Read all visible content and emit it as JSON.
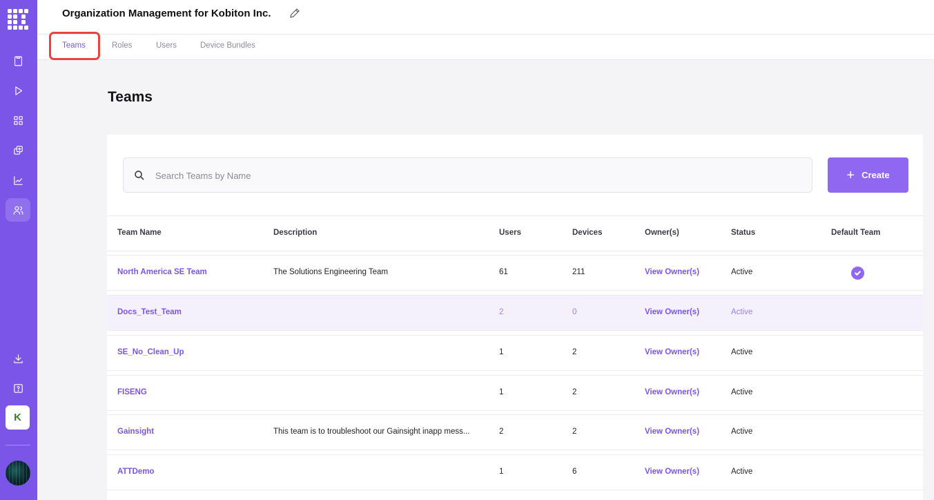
{
  "header": {
    "title": "Organization Management for Kobiton Inc."
  },
  "tabs": [
    {
      "label": "Teams",
      "selected": true
    },
    {
      "label": "Roles",
      "selected": false
    },
    {
      "label": "Users",
      "selected": false
    },
    {
      "label": "Device Bundles",
      "selected": false
    }
  ],
  "sidebar": {
    "icons": [
      "logo-icon",
      "clipboard-icon",
      "play-icon",
      "grid-icon",
      "copy-icon",
      "chart-icon",
      "users-icon",
      "download-icon",
      "help-icon"
    ],
    "org_badge": "K"
  },
  "page": {
    "title": "Teams"
  },
  "search": {
    "placeholder": "Search Teams by Name",
    "value": ""
  },
  "create_button": {
    "label": "Create"
  },
  "table": {
    "columns": [
      "Team Name",
      "Description",
      "Users",
      "Devices",
      "Owner(s)",
      "Status",
      "Default Team"
    ],
    "rows": [
      {
        "name": "North America SE Team",
        "description": "The Solutions Engineering Team",
        "users": "61",
        "devices": "211",
        "owners": "View Owner(s)",
        "status": "Active",
        "default": true
      },
      {
        "name": "Docs_Test_Team",
        "description": "",
        "users": "2",
        "devices": "0",
        "owners": "View Owner(s)",
        "status": "Active",
        "default": false
      },
      {
        "name": "SE_No_Clean_Up",
        "description": "",
        "users": "1",
        "devices": "2",
        "owners": "View Owner(s)",
        "status": "Active",
        "default": false
      },
      {
        "name": "FISENG",
        "description": "",
        "users": "1",
        "devices": "2",
        "owners": "View Owner(s)",
        "status": "Active",
        "default": false
      },
      {
        "name": "Gainsight",
        "description": "This team is to troubleshoot our Gainsight inapp mess...",
        "users": "2",
        "devices": "2",
        "owners": "View Owner(s)",
        "status": "Active",
        "default": false
      },
      {
        "name": "ATTDemo",
        "description": "",
        "users": "1",
        "devices": "6",
        "owners": "View Owner(s)",
        "status": "Active",
        "default": false
      }
    ]
  },
  "colors": {
    "brand": "#7b54e8",
    "button": "#8f67f0",
    "highlight": "#e8443f"
  }
}
